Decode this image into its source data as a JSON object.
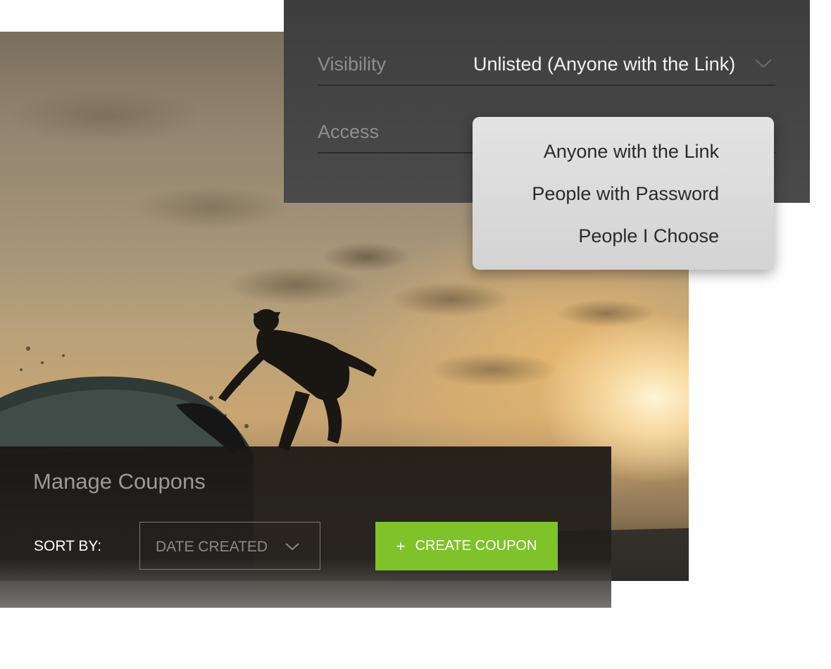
{
  "visibility": {
    "label": "Visibility",
    "value": "Unlisted (Anyone with the Link)"
  },
  "access": {
    "label": "Access",
    "options": [
      "Anyone with the Link",
      "People with Password",
      "People I Choose"
    ]
  },
  "coupons": {
    "title": "Manage Coupons",
    "sort_label": "SORT BY:",
    "sort_value": "DATE CREATED",
    "create_label": "CREATE COUPON",
    "create_icon": "+"
  },
  "colors": {
    "accent": "#7fc22a",
    "panel": "#444444"
  }
}
